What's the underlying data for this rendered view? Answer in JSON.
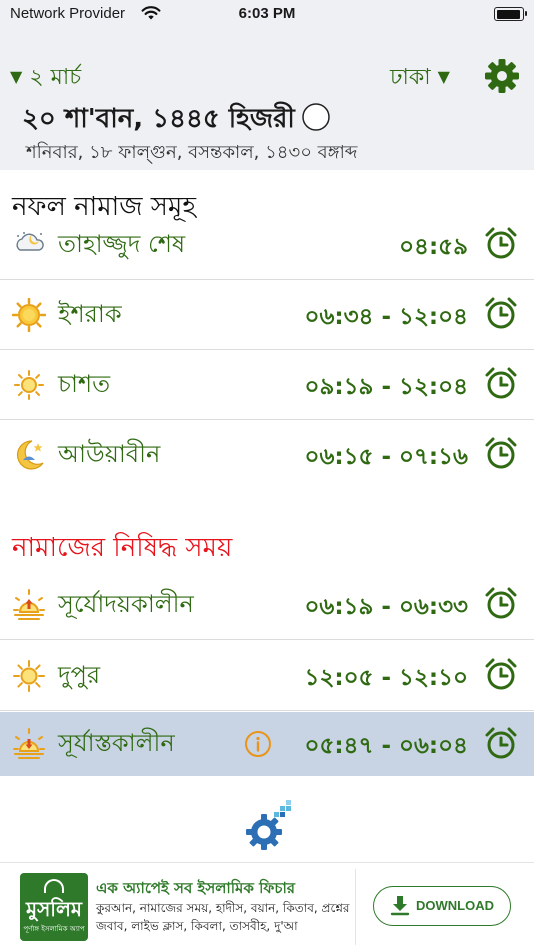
{
  "status_bar": {
    "carrier": "Network Provider",
    "time": "6:03 PM",
    "battery_level": 0.95
  },
  "header": {
    "date_selector": "২ মার্চ",
    "city_selector": "ঢাকা",
    "hijri_date": "২০ শা'বান, ১৪৪৫ হিজরী",
    "bangla_date": "শনিবার, ১৮ ফাল্গুন, বসন্তকাল, ১৪৩০ বঙ্গাব্দ"
  },
  "nafl": {
    "title": "নফল নামাজ সমূহ",
    "items": [
      {
        "name": "তাহাজ্জুদ শেষ",
        "time": "০৪:৫৯",
        "icon": "night-cloud-icon"
      },
      {
        "name": "ইশরাক",
        "time": "০৬:৩৪ - ১২:০৪",
        "icon": "sun-icon"
      },
      {
        "name": "চাশত",
        "time": "০৯:১৯ - ১২:০৪",
        "icon": "small-sun-icon"
      },
      {
        "name": "আউয়াবীন",
        "time": "০৬:১৫ - ০৭:১৬",
        "icon": "moon-star-icon"
      }
    ]
  },
  "forbidden": {
    "title": "নামাজের নিষিদ্ধ সময়",
    "items": [
      {
        "name": "সূর্যোদয়কালীন",
        "time": "০৬:১৯ - ০৬:৩৩",
        "icon": "sunrise-icon"
      },
      {
        "name": "দুপুর",
        "time": "১২:০৫ - ১২:১০",
        "icon": "sun-icon"
      },
      {
        "name": "সূর্যাস্তকালীন",
        "time": "০৫:৪৭ - ০৬:০৪",
        "icon": "sunset-icon"
      }
    ]
  },
  "ad": {
    "logo_text": "মুসলিম",
    "logo_subtext": "পূর্ণাঙ্গ ইসলামিক অ্যাপ",
    "title": "এক অ্যাপেই সব ইসলামিক ফিচার",
    "description": "কুরআন, নামাজের সময়, হাদীস, বয়ান, কিতাব, প্রশ্নের জবাব, লাইভ ক্লাস, কিবলা, তাসবীহ, দু'আ",
    "button_label": "DOWNLOAD"
  },
  "colors": {
    "accent_green": "#2f6a12",
    "forbidden_red": "#e8121a",
    "highlight_row": "#c8d3e3",
    "header_bg": "#eef0f3"
  }
}
